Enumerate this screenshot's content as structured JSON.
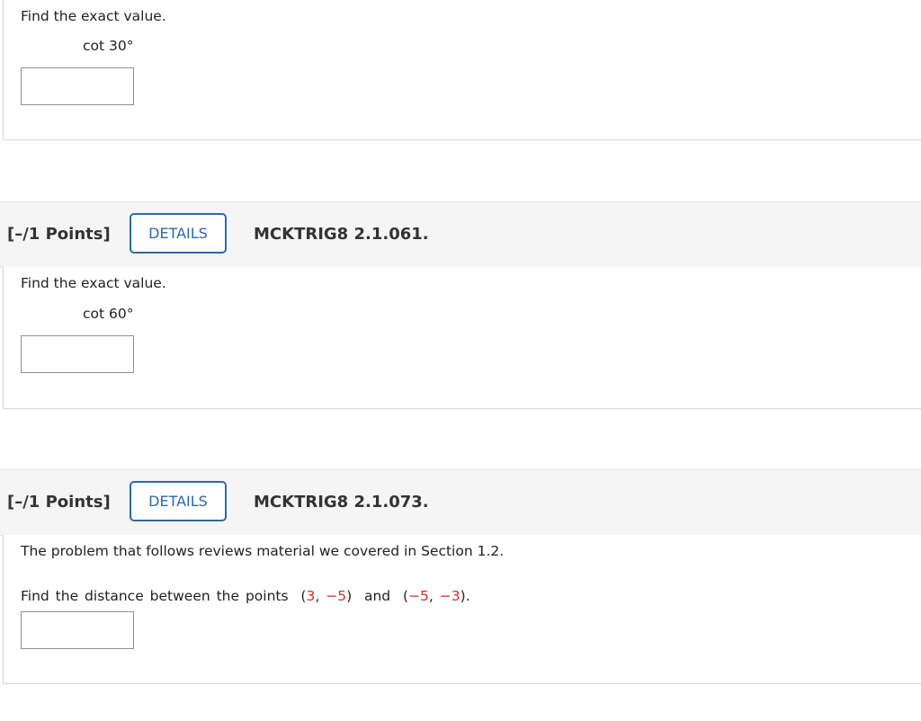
{
  "questions": [
    {
      "prompt": "Find the exact value.",
      "expression": "cot 30°",
      "answer": ""
    },
    {
      "points": "[–/1 Points]",
      "details_label": "DETAILS",
      "code": "MCKTRIG8 2.1.061.",
      "prompt": "Find the exact value.",
      "expression": "cot 60°",
      "answer": ""
    },
    {
      "points": "[–/1 Points]",
      "details_label": "DETAILS",
      "code": "MCKTRIG8 2.1.073.",
      "intro": "The problem that follows reviews material we covered in Section 1.2.",
      "prompt_start": "Find the distance between the points",
      "point1": {
        "x": "3",
        "y": "−5"
      },
      "connector": "and",
      "point2": {
        "x": "−5",
        "y": "−3"
      },
      "prompt_end": ".",
      "answer": ""
    }
  ],
  "colors": {
    "details_border": "#2c6aa5",
    "highlight": "#d0302a"
  }
}
